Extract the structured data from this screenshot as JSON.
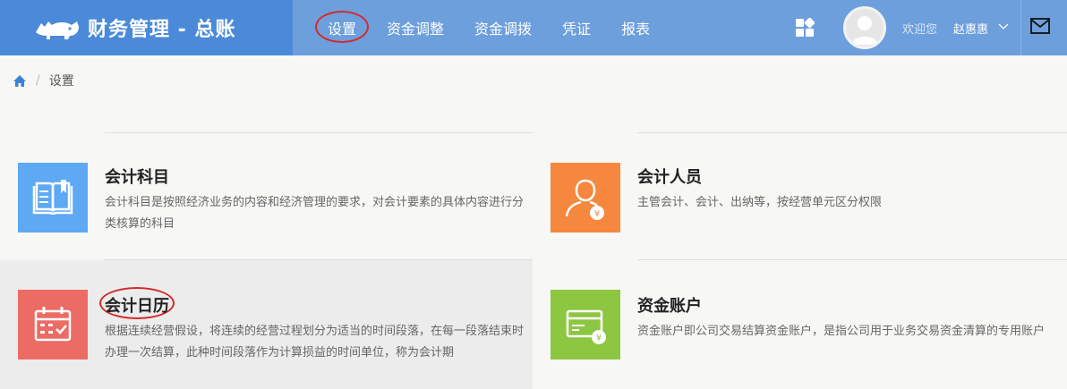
{
  "header": {
    "brand_title": "财务管理 - 总账",
    "nav": [
      {
        "label": "设置"
      },
      {
        "label": "资金调整"
      },
      {
        "label": "资金调拨"
      },
      {
        "label": "凭证"
      },
      {
        "label": "报表"
      }
    ],
    "welcome_text": "欢迎您",
    "username": "赵惠惠"
  },
  "breadcrumb": {
    "current": "设置"
  },
  "cards": [
    {
      "title": "会计科目",
      "desc": "会计科目是按照经济业务的内容和经济管理的要求，对会计要素的具体内容进行分类核算的科目",
      "icon": "book-icon",
      "color": "#5da9f3"
    },
    {
      "title": "会计人员",
      "desc": "主管会计、会计、出纳等，按经营单元区分权限",
      "icon": "accountant-icon",
      "color": "#f5883e"
    },
    {
      "title": "会计日历",
      "desc": "根据连续经营假设，将连续的经营过程划分为适当的时间段落，在每一段落结束时办理一次结算，此种时间段落作为计算损益的时间单位，称为会计期",
      "icon": "calendar-icon",
      "color": "#ec6b64"
    },
    {
      "title": "资金账户",
      "desc": "资金账户即公司交易结算资金账户，是指公司用于业务交易资金清算的专用账户",
      "icon": "money-card-icon",
      "color": "#8dc641"
    }
  ],
  "colors": {
    "header_bg": "#6d9fdc",
    "brand_bg": "#4a8ad8",
    "annotation": "#d42a2a"
  }
}
